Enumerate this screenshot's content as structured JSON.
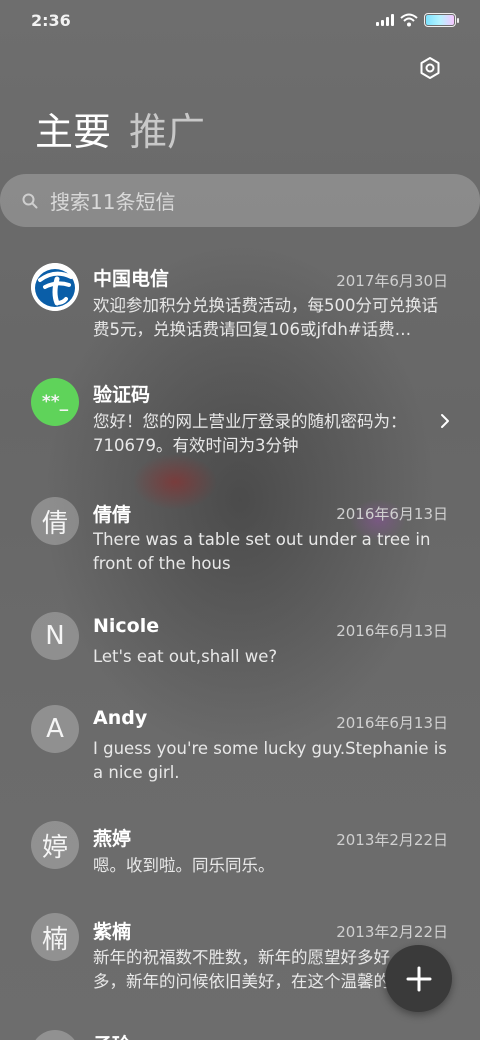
{
  "status_bar": {
    "time": "2:36"
  },
  "tabs": [
    {
      "label": "主要"
    },
    {
      "label": "推广"
    }
  ],
  "search": {
    "placeholder": "搜索11条短信"
  },
  "messages": [
    {
      "name": "中国电信",
      "date": "2017年6月30日",
      "preview": "欢迎参加积分兑换话费活动，每500分可兑换话费5元，兑换话费请回复106或jfdh#话费…",
      "avatar": "telecom"
    },
    {
      "name": "验证码",
      "date": "",
      "preview": "您好！您的网上营业厅登录的随机密码为：710679。有效时间为3分钟",
      "avatar_text": "**_"
    },
    {
      "name": "倩倩",
      "date": "2016年6月13日",
      "preview": "There was a table set out under a tree in front of the hous",
      "avatar_text": "倩"
    },
    {
      "name": "Nicole",
      "date": "2016年6月13日",
      "preview": "Let's eat out,shall we?",
      "avatar_text": "N"
    },
    {
      "name": "Andy",
      "date": "2016年6月13日",
      "preview": "I guess you're some lucky guy.Stephanie is a nice girl.",
      "avatar_text": "A"
    },
    {
      "name": "燕婷",
      "date": "2013年2月22日",
      "preview": "嗯。收到啦。同乐同乐。",
      "avatar_text": "婷"
    },
    {
      "name": "紫楠",
      "date": "2013年2月22日",
      "preview": "新年的祝福数不胜数，新年的愿望好多好多，新年的问候依旧美好，在这个温馨的时刻",
      "avatar_text": "楠"
    },
    {
      "name": "子玲",
      "date": "",
      "preview": "",
      "avatar_text": ""
    }
  ],
  "icons": {
    "settings": "gear-icon",
    "search": "search-icon",
    "chevron": "chevron-right-icon",
    "compose": "plus-icon"
  },
  "colors": {
    "verification_avatar": "#5fd35a",
    "telecom_blue": "#0a5ea8",
    "fab": "#3a3a3a"
  }
}
